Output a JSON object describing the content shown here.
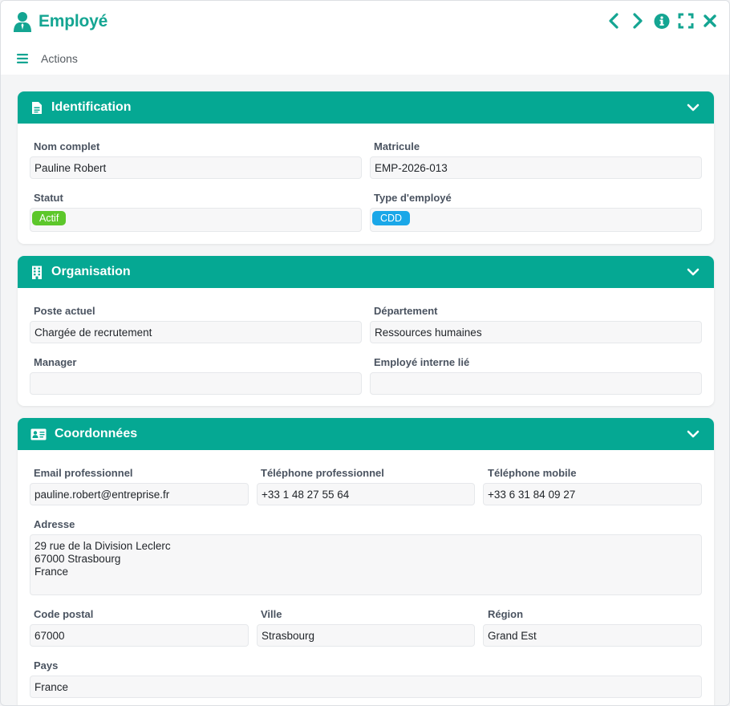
{
  "header": {
    "title": "Employé",
    "actions_label": "Actions",
    "icons": [
      "user-tie-icon",
      "chevron-left-icon",
      "chevron-right-icon",
      "info-icon",
      "expand-icon",
      "close-icon",
      "menu-icon"
    ]
  },
  "colors": {
    "accent": "#05a893",
    "status_active": "#5dc72b",
    "type_badge": "#1aa7e8"
  },
  "identification": {
    "title": "Identification",
    "nom_label": "Nom complet",
    "nom_value": "Pauline Robert",
    "matricule_label": "Matricule",
    "matricule_value": "EMP-2026-013",
    "statut_label": "Statut",
    "statut_value": "Actif",
    "type_label": "Type d'employé",
    "type_value": "CDD"
  },
  "organisation": {
    "title": "Organisation",
    "poste_label": "Poste actuel",
    "poste_value": "Chargée de recrutement",
    "departement_label": "Département",
    "departement_value": "Ressources humaines",
    "manager_label": "Manager",
    "manager_value": "",
    "interne_label": "Employé interne lié",
    "interne_value": ""
  },
  "coordonnees": {
    "title": "Coordonnées",
    "email_label": "Email professionnel",
    "email_value": "pauline.robert@entreprise.fr",
    "tel_pro_label": "Téléphone professionnel",
    "tel_pro_value": "+33 1 48 27 55 64",
    "tel_mobile_label": "Téléphone mobile",
    "tel_mobile_value": "+33 6 31 84 09 27",
    "adresse_label": "Adresse",
    "adresse_value": "29 rue de la Division Leclerc\n67000 Strasbourg\nFrance",
    "cp_label": "Code postal",
    "cp_value": "67000",
    "ville_label": "Ville",
    "ville_value": "Strasbourg",
    "region_label": "Région",
    "region_value": "Grand Est",
    "pays_label": "Pays",
    "pays_value": "France"
  }
}
